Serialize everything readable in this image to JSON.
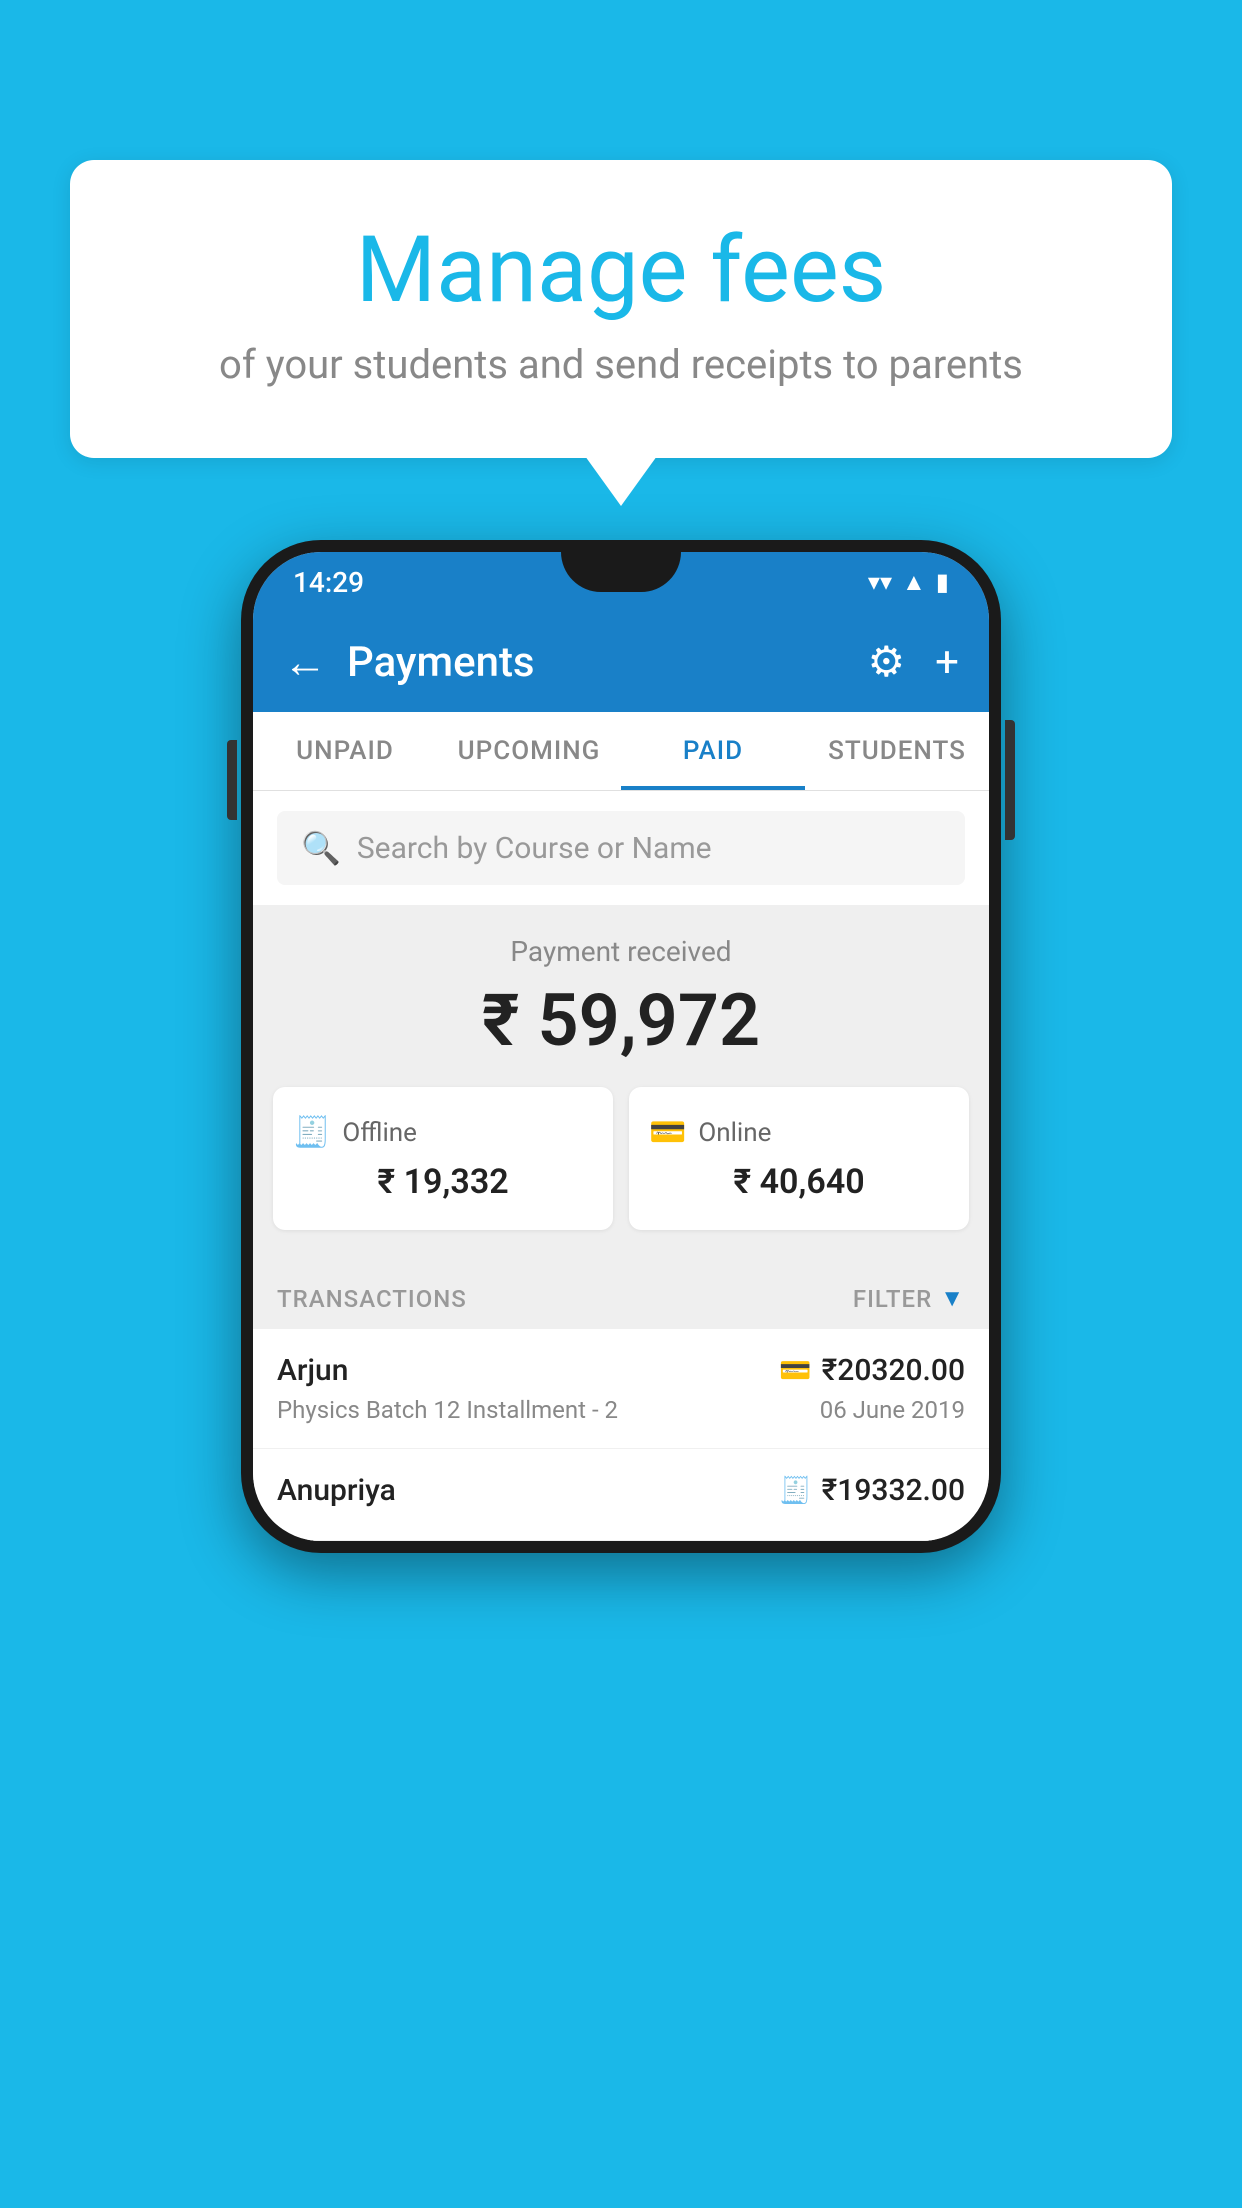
{
  "background_color": "#1ab8e8",
  "speech_bubble": {
    "title": "Manage fees",
    "subtitle": "of your students and send receipts to parents"
  },
  "phone": {
    "status_bar": {
      "time": "14:29",
      "wifi_icon": "▼",
      "signal_icon": "▲",
      "battery_icon": "▮"
    },
    "app_bar": {
      "back_label": "←",
      "title": "Payments",
      "settings_label": "⚙",
      "add_label": "+"
    },
    "tabs": [
      {
        "id": "unpaid",
        "label": "UNPAID",
        "active": false
      },
      {
        "id": "upcoming",
        "label": "UPCOMING",
        "active": false
      },
      {
        "id": "paid",
        "label": "PAID",
        "active": true
      },
      {
        "id": "students",
        "label": "STUDENTS",
        "active": false
      }
    ],
    "search": {
      "placeholder": "Search by Course or Name",
      "search_icon": "🔍"
    },
    "payment_summary": {
      "label": "Payment received",
      "amount": "₹ 59,972",
      "offline": {
        "label": "Offline",
        "amount": "₹ 19,332",
        "icon": "💳"
      },
      "online": {
        "label": "Online",
        "amount": "₹ 40,640",
        "icon": "💳"
      }
    },
    "transactions": {
      "header_label": "TRANSACTIONS",
      "filter_label": "FILTER",
      "items": [
        {
          "name": "Arjun",
          "course": "Physics Batch 12 Installment - 2",
          "date": "06 June 2019",
          "amount": "₹20320.00",
          "payment_type": "online"
        },
        {
          "name": "Anupriya",
          "course": "",
          "date": "",
          "amount": "₹19332.00",
          "payment_type": "offline"
        }
      ]
    }
  }
}
